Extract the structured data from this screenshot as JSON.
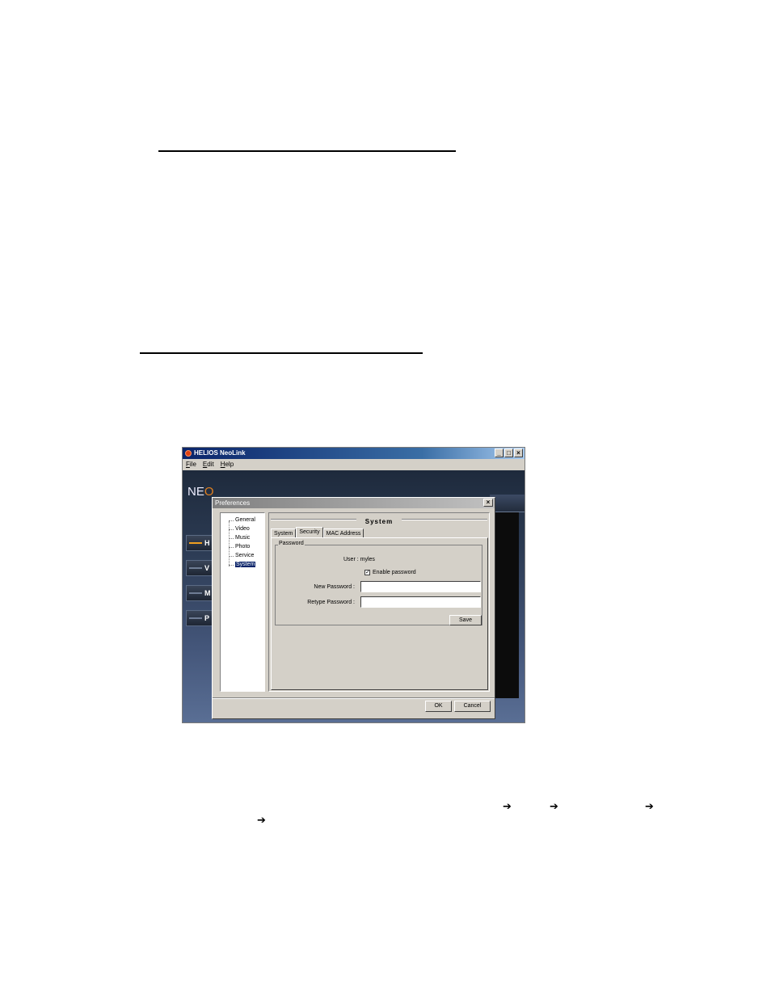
{
  "app": {
    "title": "HELIOS NeoLink",
    "window_buttons": [
      "_",
      "□",
      "×"
    ],
    "menu": [
      "File",
      "Edit",
      "Help"
    ],
    "brand_prefix": "NE",
    "brand_o": "O",
    "nav": [
      {
        "label": "H",
        "active": true
      },
      {
        "label": "V",
        "active": false
      },
      {
        "label": "M",
        "active": false
      },
      {
        "label": "P",
        "active": false
      }
    ]
  },
  "dialog": {
    "title": "Preferences",
    "close": "×",
    "tree": [
      "General",
      "Video",
      "Music",
      "Photo",
      "Service",
      "System"
    ],
    "selected_tree_item": "System",
    "section_title": "System",
    "tabs": [
      "System",
      "Security",
      "MAC Address"
    ],
    "active_tab": "Security",
    "group_label": "Password",
    "user_text": "User : myles",
    "enable_password_label": "Enable password",
    "enable_password_checked": true,
    "check_mark": "✓",
    "new_password_label": "New Password :",
    "new_password_value": "",
    "retype_password_label": "Retype Password :",
    "retype_password_value": "",
    "save": "Save",
    "ok": "OK",
    "cancel": "Cancel"
  },
  "arrow_glyph": "➔",
  "colors": {
    "titlebar_start": "#0a246a",
    "dialog_face": "#d4d0c8",
    "selection": "#0a246a",
    "active_nav_accent": "#f0a020"
  }
}
